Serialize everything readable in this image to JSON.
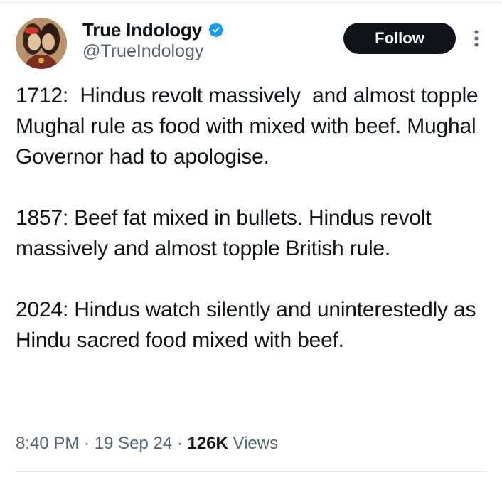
{
  "author": {
    "display_name": "True Indology",
    "handle": "@TrueIndology",
    "verified_color": "#1d9bf0"
  },
  "actions": {
    "follow_label": "Follow"
  },
  "tweet": {
    "paragraphs": [
      "1712:  Hindus revolt massively  and almost topple Mughal rule as food with mixed with beef. Mughal Governor had to apologise.",
      "1857: Beef fat mixed in bullets. Hindus revolt massively and almost topple British rule.",
      "2024: Hindus watch silently and uninterestedly as Hindu sacred food mixed with beef."
    ]
  },
  "meta": {
    "time": "8:40 PM",
    "separator": " · ",
    "date": "19 Sep 24",
    "views_count": "126K",
    "views_label": " Views"
  },
  "icons": {
    "avatar": "avatar-painting-icon",
    "verified": "verified-badge-icon",
    "more": "more-options-icon"
  },
  "colors": {
    "text": "#0f1419",
    "secondary": "#536471",
    "follow_bg": "#0f1419",
    "follow_text": "#ffffff"
  }
}
